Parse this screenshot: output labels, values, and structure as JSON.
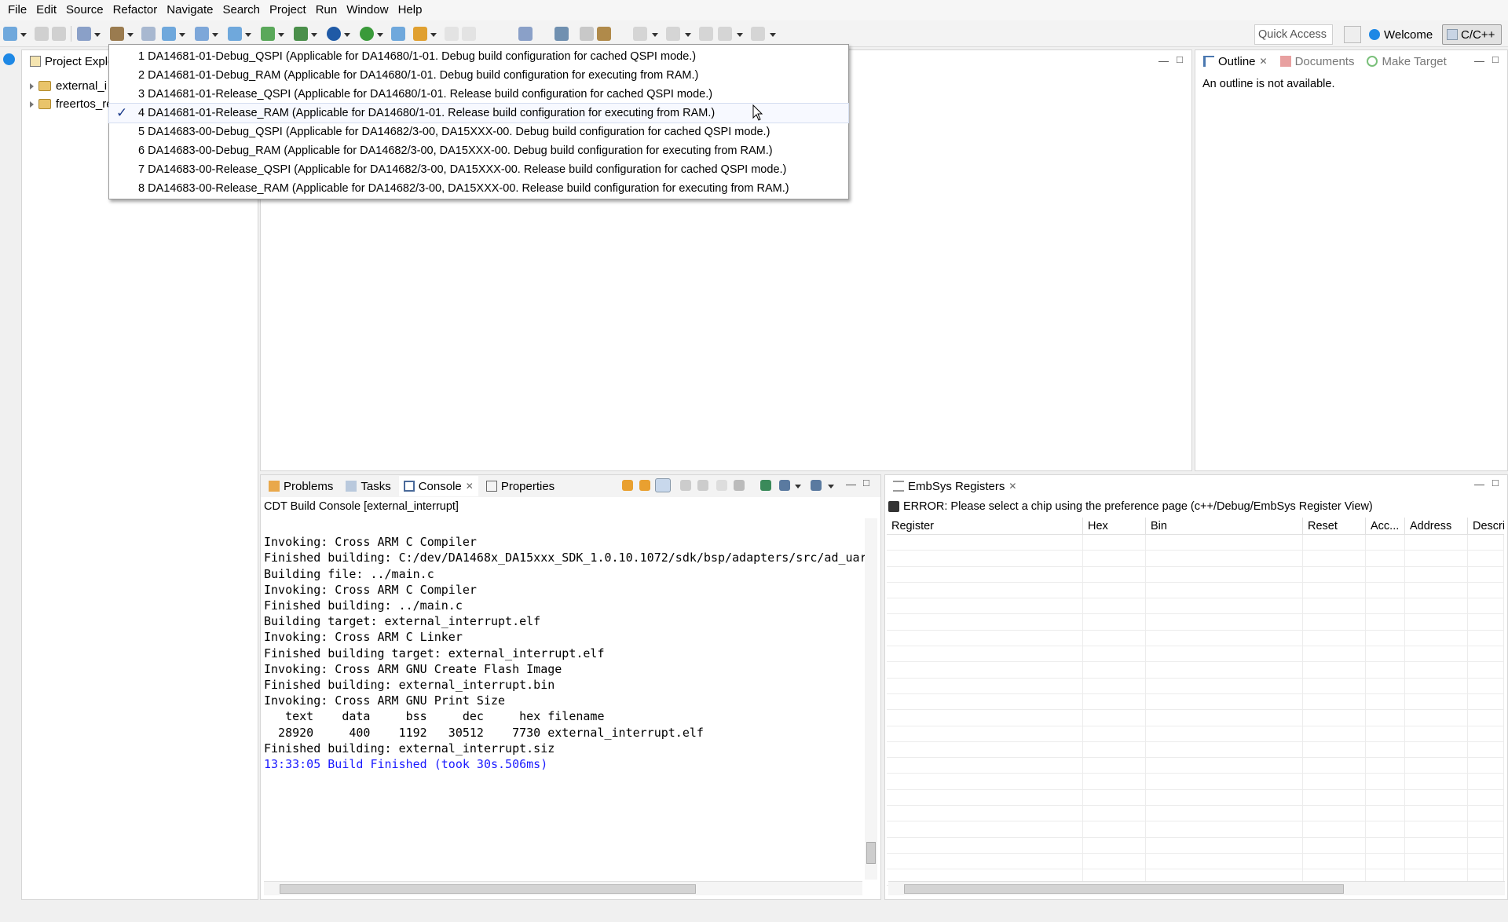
{
  "menubar": {
    "items": [
      "File",
      "Edit",
      "Source",
      "Refactor",
      "Navigate",
      "Search",
      "Project",
      "Run",
      "Window",
      "Help"
    ]
  },
  "toolbar": {
    "quick_access": "Quick Access",
    "welcome_label": "Welcome",
    "perspective_label": "C/C++"
  },
  "project_explorer": {
    "title": "Project Explo",
    "items": [
      {
        "label": "external_i",
        "icon": "project-folder-icon"
      },
      {
        "label": "freertos_re",
        "icon": "project-folder-icon"
      }
    ]
  },
  "build_config_menu": {
    "selected_index": 3,
    "items": [
      "1 DA14681-01-Debug_QSPI (Applicable for DA14680/1-01. Debug build configuration for cached QSPI mode.)",
      "2 DA14681-01-Debug_RAM (Applicable for DA14680/1-01. Debug build configuration for executing from RAM.)",
      "3 DA14681-01-Release_QSPI (Applicable for DA14680/1-01. Release build configuration for cached QSPI mode.)",
      "4 DA14681-01-Release_RAM (Applicable for DA14680/1-01. Release build configuration for executing from RAM.)",
      "5 DA14683-00-Debug_QSPI (Applicable for DA14682/3-00, DA15XXX-00. Debug build configuration for cached QSPI mode.)",
      "6 DA14683-00-Debug_RAM (Applicable for DA14682/3-00, DA15XXX-00. Debug build configuration for executing from RAM.)",
      "7 DA14683-00-Release_QSPI (Applicable for DA14682/3-00, DA15XXX-00. Release build configuration for cached QSPI mode.)",
      "8 DA14683-00-Release_RAM (Applicable for DA14682/3-00, DA15XXX-00. Release build configuration for executing from RAM.)"
    ]
  },
  "outline": {
    "tabs": [
      "Outline",
      "Documents",
      "Make Target"
    ],
    "message": "An outline is not available."
  },
  "console": {
    "tabs": [
      "Problems",
      "Tasks",
      "Console",
      "Properties"
    ],
    "header": "CDT Build Console [external_interrupt]",
    "lines": [
      "Invoking: Cross ARM C Compiler",
      "Finished building: C:/dev/DA1468x_DA15xxx_SDK_1.0.10.1072/sdk/bsp/adapters/src/ad_uar",
      "",
      "Building file: ../main.c",
      "Invoking: Cross ARM C Compiler",
      "Finished building: ../main.c",
      "",
      "Building target: external_interrupt.elf",
      "Invoking: Cross ARM C Linker",
      "Finished building target: external_interrupt.elf",
      "",
      "Invoking: Cross ARM GNU Create Flash Image",
      "Finished building: external_interrupt.bin",
      "",
      "Invoking: Cross ARM GNU Print Size",
      "   text    data     bss     dec     hex filename",
      "  28920     400    1192   30512    7730 external_interrupt.elf",
      "Finished building: external_interrupt.siz",
      "",
      ""
    ],
    "final_line": "13:33:05 Build Finished (took 30s.506ms)",
    "final_color": "#1a1aff"
  },
  "registers": {
    "tab": "EmbSys Registers",
    "error": "ERROR: Please select a chip using the preference page (c++/Debug/EmbSys Register View)",
    "columns": [
      "Register",
      "Hex",
      "Bin",
      "Reset",
      "Acc...",
      "Address",
      "Descri"
    ]
  }
}
